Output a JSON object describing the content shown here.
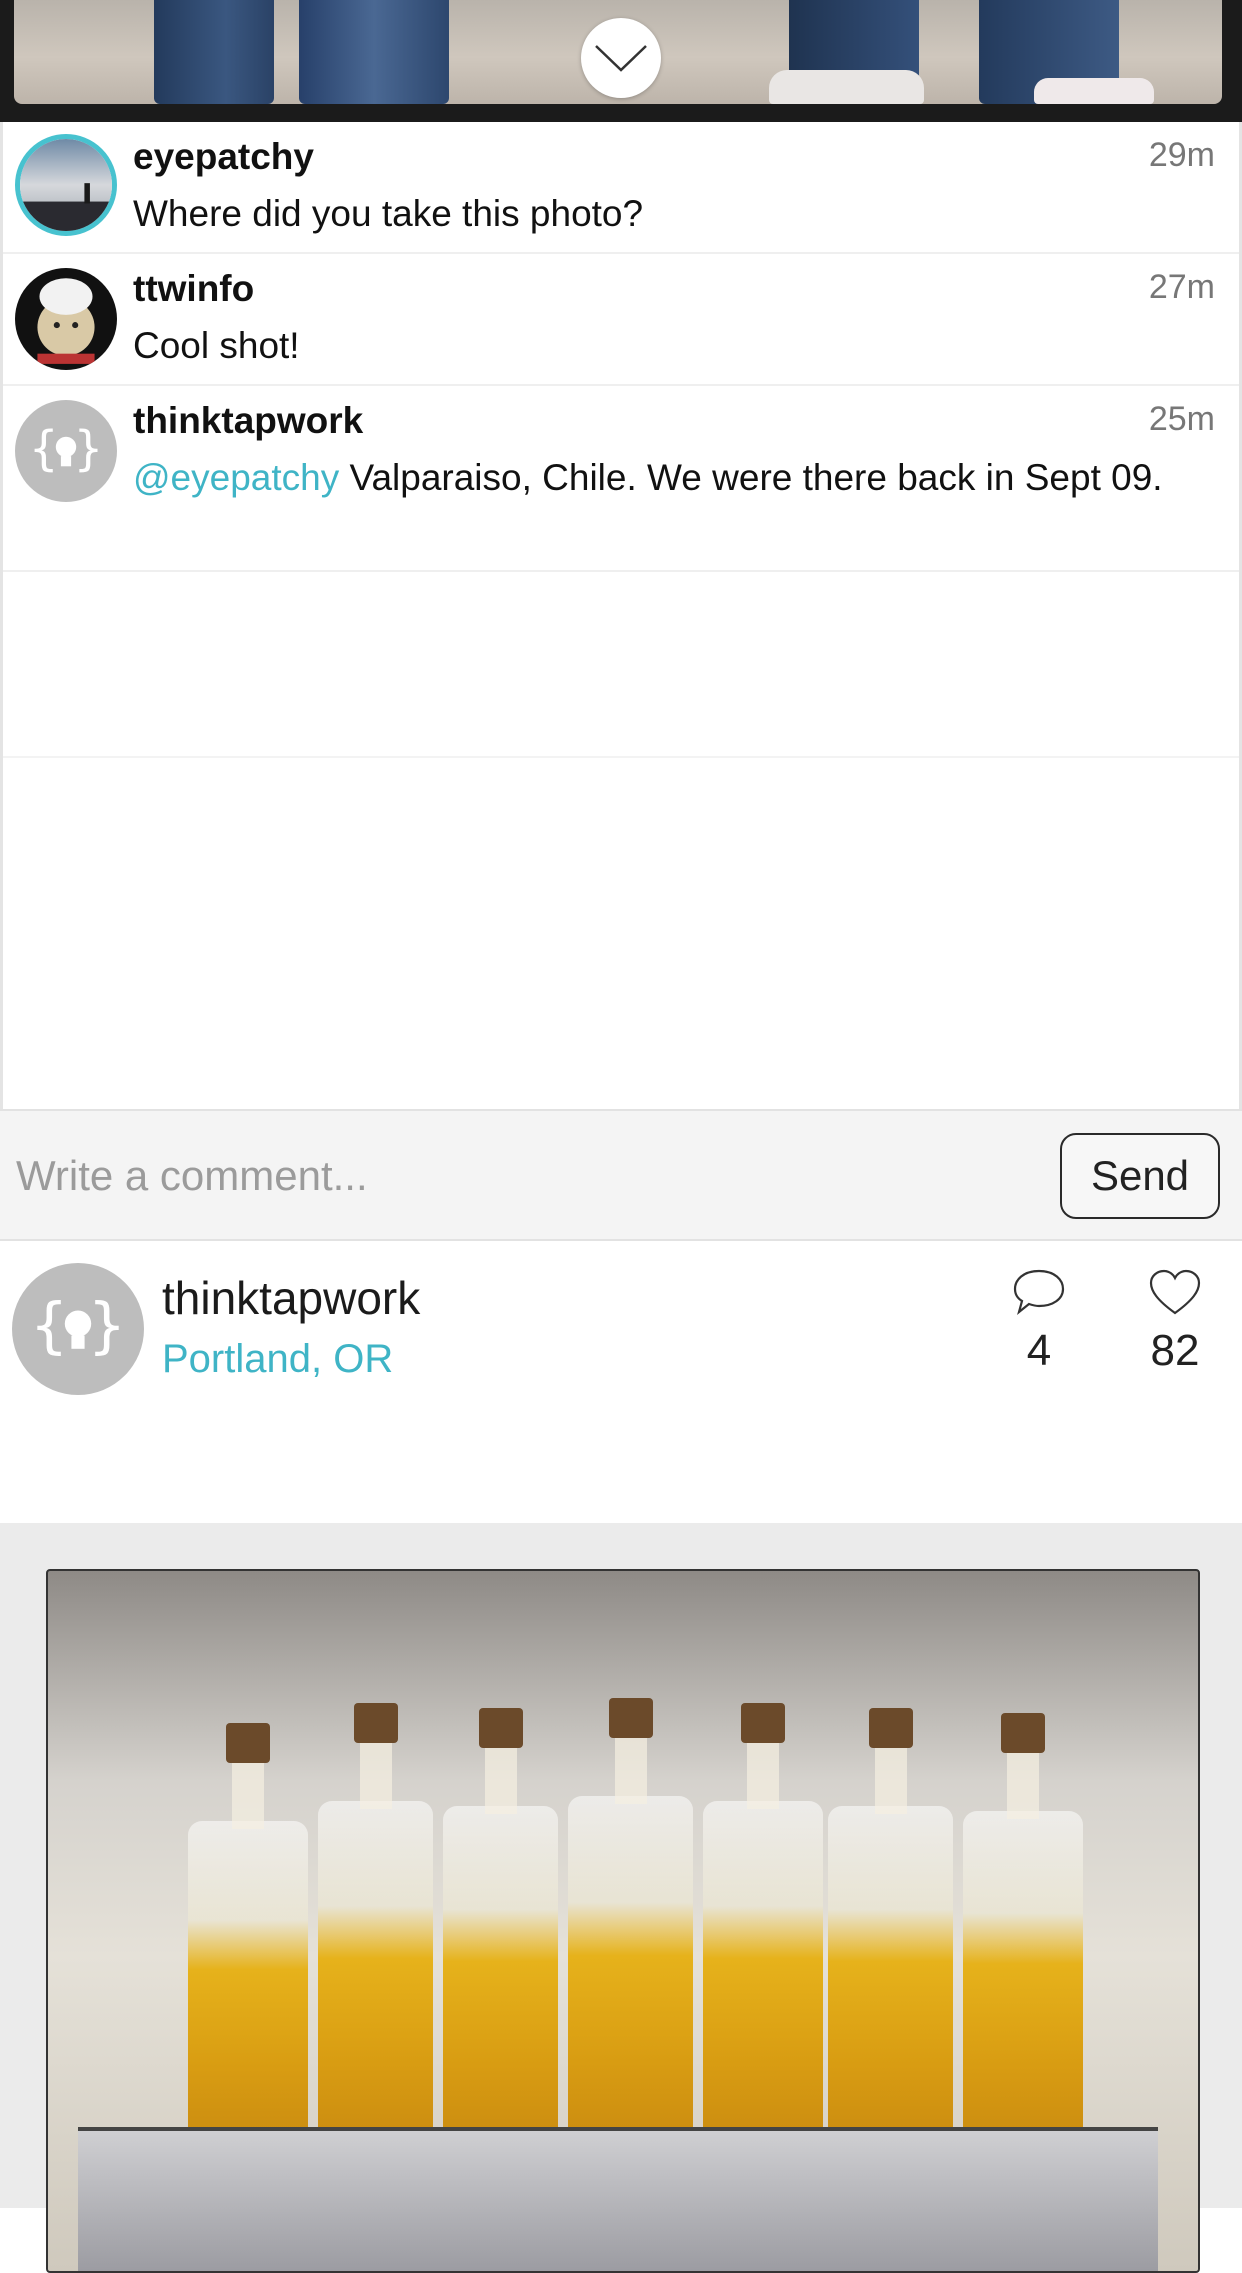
{
  "comments": [
    {
      "username": "eyepatchy",
      "time": "29m",
      "text": "Where did you take this photo?"
    },
    {
      "username": "ttwinfo",
      "time": "27m",
      "text": "Cool shot!"
    },
    {
      "username": "thinktapwork",
      "time": "25m",
      "mention": "@eyepatchy",
      "text": " Valparaiso, Chile. We were there back in Sept 09."
    }
  ],
  "compose": {
    "placeholder": "Write a comment...",
    "send_label": "Send"
  },
  "post": {
    "username": "thinktapwork",
    "location": "Portland, OR",
    "comment_count": "4",
    "like_count": "82"
  },
  "colors": {
    "accent": "#3fb4c6",
    "text": "#111111",
    "muted": "#777777"
  },
  "icons": {
    "collapse": "chevron-down-icon",
    "comments": "speech-bubble-icon",
    "likes": "heart-icon"
  }
}
